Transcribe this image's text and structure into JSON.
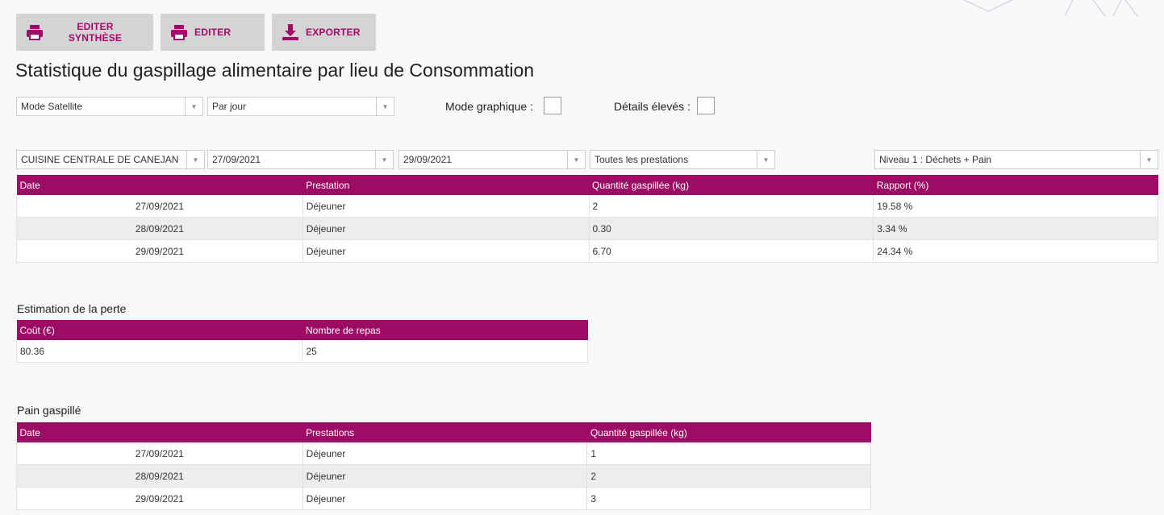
{
  "toolbar": {
    "edit_summary_label": "EDITER SYNTHÈSE",
    "edit_label": "EDITER",
    "export_label": "EXPORTER",
    "accent_color": "#a3086a"
  },
  "page_title": "Statistique du gaspillage alimentaire par lieu de Consommation",
  "filters": {
    "mode": "Mode Satellite",
    "period": "Par jour",
    "graphic_mode_label": "Mode graphique :",
    "high_details_label": "Détails élevés :",
    "site": "CUISINE CENTRALE DE CANEJAN",
    "date_from": "27/09/2021",
    "date_to": "29/09/2021",
    "prestations": "Toutes les prestations",
    "level": "Niveau 1 : Déchets + Pain"
  },
  "main_table": {
    "headers": [
      "Date",
      "Prestation",
      "Quantité gaspillée (kg)",
      "Rapport (%)"
    ],
    "rows": [
      [
        "27/09/2021",
        "Déjeuner",
        "2",
        "19.58 %"
      ],
      [
        "28/09/2021",
        "Déjeuner",
        "0.30",
        "3.34 %"
      ],
      [
        "29/09/2021",
        "Déjeuner",
        "6.70",
        "24.34 %"
      ]
    ]
  },
  "loss_estimation": {
    "title": "Estimation de la perte",
    "headers": [
      "Coût (€)",
      "Nombre de repas"
    ],
    "rows": [
      [
        "80.36",
        "25"
      ]
    ]
  },
  "bread_waste": {
    "title": "Pain gaspillé",
    "headers": [
      "Date",
      "Prestations",
      "Quantité gaspillée (kg)"
    ],
    "rows": [
      [
        "27/09/2021",
        "Déjeuner",
        "1"
      ],
      [
        "28/09/2021",
        "Déjeuner",
        "2"
      ],
      [
        "29/09/2021",
        "Déjeuner",
        "3"
      ]
    ]
  },
  "header_color": "#9c0c64"
}
